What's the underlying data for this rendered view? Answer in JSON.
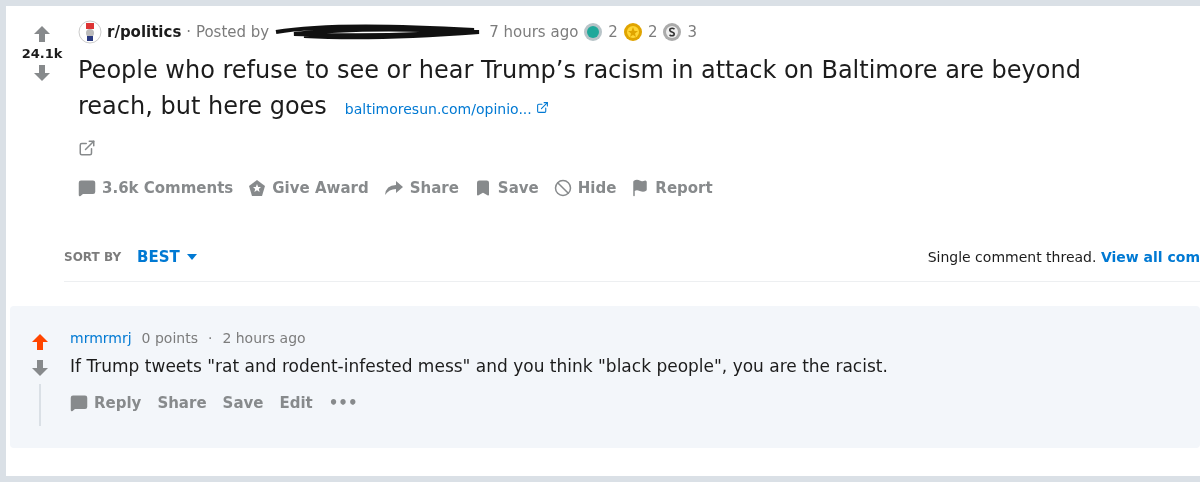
{
  "post": {
    "score": "24.1k",
    "upvoted": false,
    "downvoted": false,
    "subreddit": "r/politics",
    "posted_by": "· Posted by",
    "time": "7 hours ago",
    "awards": [
      {
        "kind": "silver",
        "count": "2"
      },
      {
        "kind": "gold",
        "count": "2"
      },
      {
        "kind": "coin",
        "count": "3"
      }
    ],
    "title": "People who refuse to see or hear Trump’s racism in attack on Baltimore are beyond reach, but here goes",
    "link": "baltimoresun.com/opinio...",
    "actions": [
      {
        "kind": "comments",
        "label": "3.6k Comments"
      },
      {
        "kind": "award",
        "label": "Give Award"
      },
      {
        "kind": "share",
        "label": "Share"
      },
      {
        "kind": "save",
        "label": "Save"
      },
      {
        "kind": "hide",
        "label": "Hide"
      },
      {
        "kind": "report",
        "label": "Report"
      }
    ]
  },
  "sort": {
    "label": "SORT BY",
    "value": "BEST"
  },
  "thread_notice": {
    "text": "Single comment thread.",
    "link": "View all com"
  },
  "comment": {
    "upvoted": true,
    "downvoted": false,
    "author": "mrmrmrj",
    "points": "0 points",
    "separator": "·",
    "time": "2 hours ago",
    "body": "If Trump tweets \"rat and rodent-infested mess\" and you think \"black people\", you are the racist.",
    "actions": [
      {
        "kind": "reply",
        "label": "Reply"
      },
      {
        "kind": "text",
        "label": "Share"
      },
      {
        "kind": "text",
        "label": "Save"
      },
      {
        "kind": "text",
        "label": "Edit"
      },
      {
        "kind": "more",
        "label": "•••"
      }
    ]
  }
}
